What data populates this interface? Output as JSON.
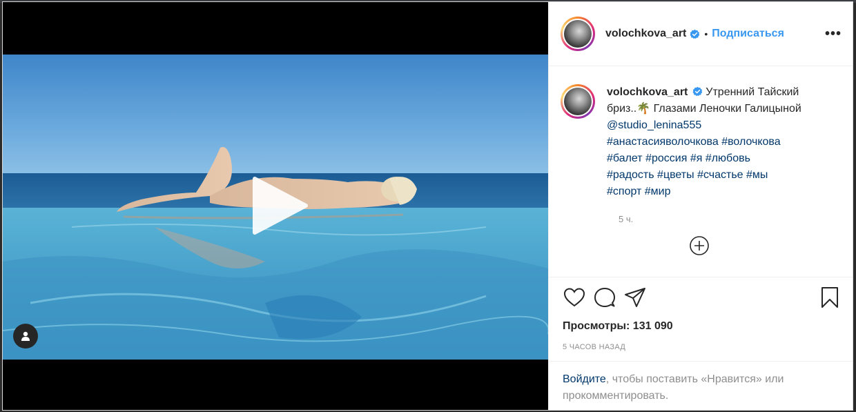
{
  "post": {
    "username": "volochkova_art",
    "follow_label": "Подписаться",
    "separator": "•",
    "more_label": "•••"
  },
  "caption": {
    "text": "Утренний Тайский бриз..🌴 Глазами Леночки Галицыной",
    "mention": "@studio_lenina555",
    "hashtags_line1": "#анастасияволочкова #волочкова",
    "hashtags_line2": "#балет #россия #я #любовь",
    "hashtags_line3": "#радость #цветы #счастье #мы",
    "hashtags_line4": "#спорт #мир",
    "time": "5 ч."
  },
  "stats": {
    "views_label": "Просмотры:",
    "views_value": "131 090",
    "timestamp": "5 ЧАСОВ НАЗАД"
  },
  "login": {
    "link": "Войдите",
    "text": ", чтобы поставить «Нравится» или прокомментировать."
  },
  "icons": {
    "verified": "verified-badge-icon",
    "like": "heart-icon",
    "comment": "comment-bubble-icon",
    "share": "paper-plane-icon",
    "save": "bookmark-icon",
    "play": "play-icon",
    "tag": "user-tag-icon",
    "load_more": "plus-circle-icon"
  },
  "colors": {
    "accent": "#3897f0",
    "link": "#00376b",
    "muted": "#8e8e8e",
    "text": "#262626"
  }
}
